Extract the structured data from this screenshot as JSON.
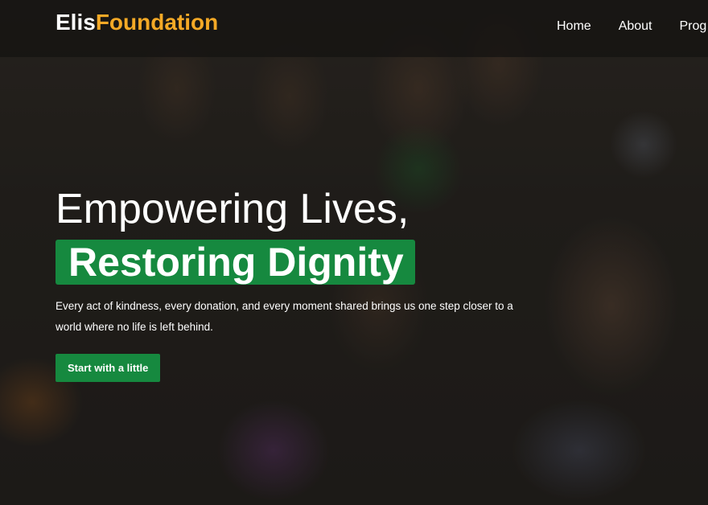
{
  "navbar": {
    "brand_part1": "Elis",
    "brand_part2": "Foundation",
    "links": [
      "Home",
      "About",
      "Prog"
    ]
  },
  "hero": {
    "headline_line1": "Empowering Lives,",
    "headline_line2": "Restoring Dignity",
    "subtext": "Every act of kindness, every donation, and every moment shared brings us one step closer to a world where no life is left behind.",
    "cta_label": "Start with a little"
  },
  "colors": {
    "accent_green": "#16893f",
    "brand_orange": "#f4a926",
    "navbar_bg": "rgba(20,18,16,0.72)"
  }
}
